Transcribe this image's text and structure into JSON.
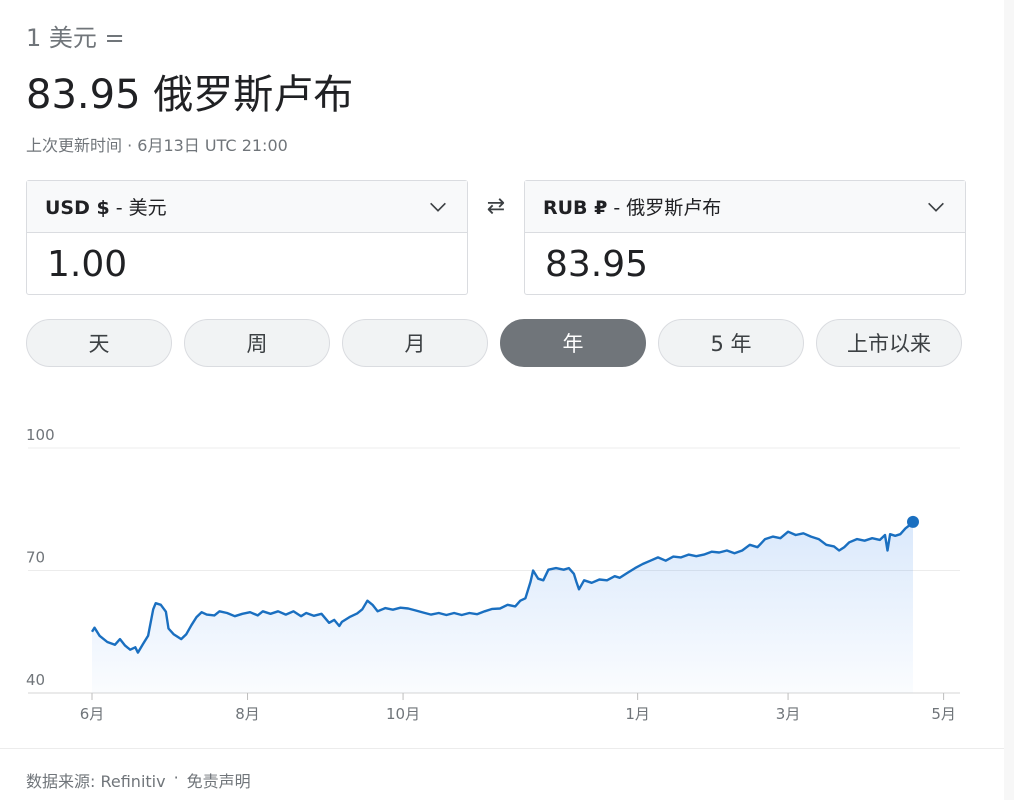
{
  "header": {
    "from_text": "1 美元 =",
    "to_text": "83.95 俄罗斯卢布",
    "updated_text": "上次更新时间 · 6月13日 UTC 21:00"
  },
  "converter": {
    "from": {
      "code": "USD $",
      "sep": "-",
      "name": "美元",
      "value": "1.00",
      "chevron_icon": "chevron-down-icon"
    },
    "swap_icon": "swap-arrows-icon",
    "swap_glyph": "⇄",
    "to": {
      "code": "RUB ₽",
      "sep": "-",
      "name": "俄罗斯卢布",
      "value": "83.95",
      "chevron_icon": "chevron-down-icon"
    }
  },
  "tabs": [
    {
      "label": "天",
      "active": false
    },
    {
      "label": "周",
      "active": false
    },
    {
      "label": "月",
      "active": false
    },
    {
      "label": "年",
      "active": true
    },
    {
      "label": "5 年",
      "active": false
    },
    {
      "label": "上市以来",
      "active": false
    }
  ],
  "chart_data": {
    "type": "area",
    "ylim": [
      40,
      100
    ],
    "y_ticks": [
      100,
      70,
      40
    ],
    "x_ticks": [
      {
        "label": "6月",
        "x": 0
      },
      {
        "label": "8月",
        "x": 61
      },
      {
        "label": "10月",
        "x": 122
      },
      {
        "label": "1月",
        "x": 214
      },
      {
        "label": "3月",
        "x": 273
      },
      {
        "label": "5月",
        "x": 334
      }
    ],
    "x_range": [
      0,
      366
    ],
    "points": [
      [
        0,
        55.0
      ],
      [
        1,
        56.0
      ],
      [
        3,
        54.0
      ],
      [
        6,
        52.5
      ],
      [
        9,
        51.8
      ],
      [
        11,
        53.2
      ],
      [
        13,
        51.6
      ],
      [
        15,
        50.6
      ],
      [
        17,
        51.2
      ],
      [
        18,
        49.9
      ],
      [
        20,
        52.0
      ],
      [
        22,
        54.0
      ],
      [
        24,
        60.5
      ],
      [
        25,
        62.0
      ],
      [
        27,
        61.6
      ],
      [
        29,
        59.9
      ],
      [
        30,
        55.8
      ],
      [
        32,
        54.4
      ],
      [
        35,
        53.2
      ],
      [
        37,
        54.4
      ],
      [
        39,
        56.6
      ],
      [
        41,
        58.6
      ],
      [
        43,
        59.8
      ],
      [
        45,
        59.2
      ],
      [
        48,
        59.0
      ],
      [
        50,
        60.0
      ],
      [
        53,
        59.6
      ],
      [
        56,
        58.8
      ],
      [
        59,
        59.4
      ],
      [
        62,
        59.8
      ],
      [
        65,
        59.0
      ],
      [
        67,
        60.0
      ],
      [
        70,
        59.4
      ],
      [
        73,
        60.0
      ],
      [
        76,
        59.2
      ],
      [
        79,
        60.0
      ],
      [
        82,
        58.8
      ],
      [
        84,
        59.6
      ],
      [
        87,
        58.9
      ],
      [
        90,
        59.4
      ],
      [
        93,
        57.2
      ],
      [
        95,
        57.9
      ],
      [
        97,
        56.4
      ],
      [
        98,
        57.4
      ],
      [
        101,
        58.6
      ],
      [
        104,
        59.5
      ],
      [
        106,
        60.5
      ],
      [
        108,
        62.6
      ],
      [
        110,
        61.6
      ],
      [
        112,
        60.0
      ],
      [
        115,
        60.8
      ],
      [
        118,
        60.4
      ],
      [
        121,
        60.9
      ],
      [
        124,
        60.7
      ],
      [
        127,
        60.2
      ],
      [
        130,
        59.7
      ],
      [
        133,
        59.2
      ],
      [
        136,
        59.6
      ],
      [
        139,
        59.1
      ],
      [
        142,
        59.6
      ],
      [
        145,
        59.1
      ],
      [
        148,
        59.6
      ],
      [
        151,
        59.3
      ],
      [
        154,
        60.0
      ],
      [
        157,
        60.6
      ],
      [
        160,
        60.7
      ],
      [
        163,
        61.6
      ],
      [
        166,
        61.2
      ],
      [
        168,
        62.6
      ],
      [
        170,
        63.2
      ],
      [
        172,
        67.2
      ],
      [
        173,
        70.0
      ],
      [
        175,
        68.0
      ],
      [
        177,
        67.6
      ],
      [
        179,
        70.2
      ],
      [
        182,
        70.6
      ],
      [
        185,
        70.2
      ],
      [
        187,
        70.6
      ],
      [
        189,
        69.2
      ],
      [
        190,
        67.2
      ],
      [
        191,
        65.4
      ],
      [
        193,
        67.6
      ],
      [
        196,
        67.0
      ],
      [
        199,
        67.8
      ],
      [
        202,
        67.6
      ],
      [
        205,
        68.6
      ],
      [
        207,
        68.2
      ],
      [
        210,
        69.4
      ],
      [
        213,
        70.6
      ],
      [
        216,
        71.6
      ],
      [
        219,
        72.4
      ],
      [
        222,
        73.2
      ],
      [
        225,
        72.4
      ],
      [
        228,
        73.4
      ],
      [
        231,
        73.2
      ],
      [
        234,
        73.9
      ],
      [
        237,
        73.5
      ],
      [
        240,
        73.9
      ],
      [
        243,
        74.6
      ],
      [
        246,
        74.4
      ],
      [
        249,
        74.9
      ],
      [
        252,
        74.2
      ],
      [
        255,
        74.9
      ],
      [
        258,
        76.3
      ],
      [
        261,
        75.7
      ],
      [
        264,
        77.7
      ],
      [
        267,
        78.3
      ],
      [
        270,
        77.9
      ],
      [
        273,
        79.5
      ],
      [
        276,
        78.7
      ],
      [
        279,
        79.1
      ],
      [
        282,
        78.3
      ],
      [
        285,
        77.7
      ],
      [
        288,
        76.3
      ],
      [
        291,
        75.9
      ],
      [
        293,
        74.9
      ],
      [
        295,
        75.7
      ],
      [
        297,
        76.9
      ],
      [
        300,
        77.7
      ],
      [
        303,
        77.3
      ],
      [
        306,
        77.9
      ],
      [
        309,
        77.5
      ],
      [
        311,
        78.7
      ],
      [
        312,
        74.9
      ],
      [
        313,
        78.9
      ],
      [
        315,
        78.5
      ],
      [
        317,
        78.9
      ],
      [
        319,
        80.3
      ],
      [
        321,
        81.3
      ],
      [
        322,
        81.9
      ]
    ],
    "endpoint_value": 81.9
  },
  "footer": {
    "source_text": "数据来源: Refinitiv",
    "dot": "·",
    "disclaimer_text": "免责声明"
  }
}
